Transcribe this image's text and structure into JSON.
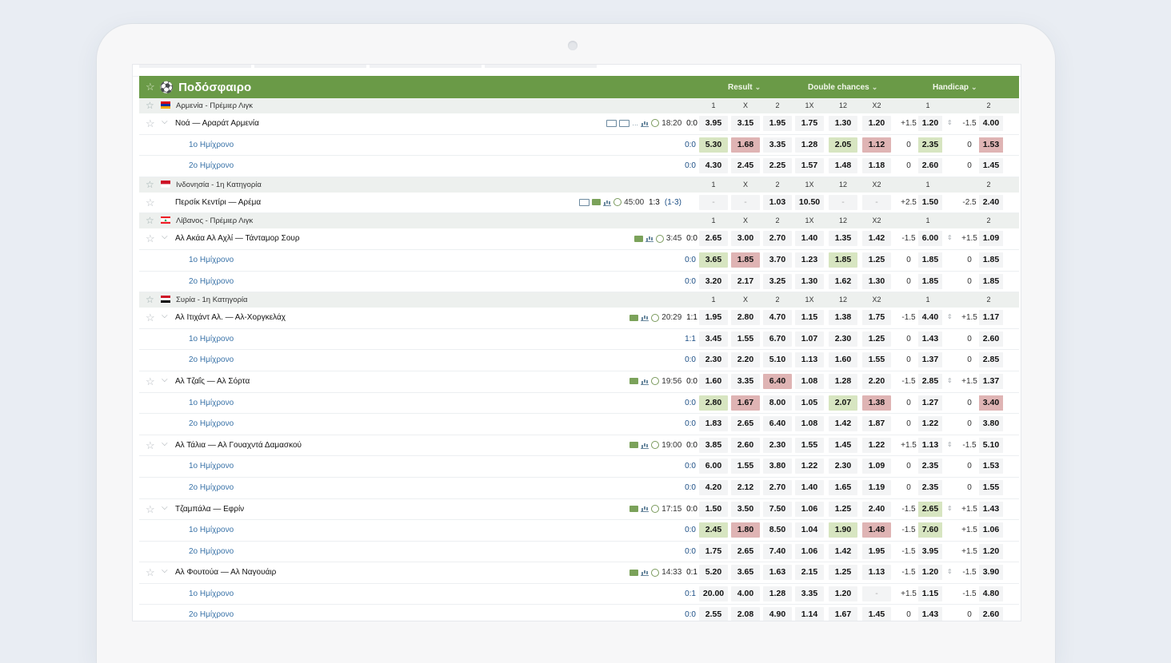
{
  "sport": {
    "title": "Ποδόσφαιρο",
    "tabs": [
      "Result",
      "Double chances",
      "Handicap"
    ]
  },
  "colLabels": [
    "1",
    "X",
    "2",
    "1X",
    "12",
    "X2",
    "1",
    "2"
  ],
  "blocks": [
    {
      "type": "league",
      "name": "Αρμενία - Πρέμιερ Λιγκ",
      "flag": "am"
    },
    {
      "type": "match",
      "name": "Νοά — Αραράτ Αρμενία",
      "icons": "tv",
      "time": "18:20",
      "score": "0:0",
      "odds": [
        "3.95",
        "3.15",
        "1.95",
        "1.75",
        "1.30",
        "1.20"
      ],
      "hc": [
        "+1.5",
        "1.20",
        "-1.5",
        "4.00"
      ],
      "colors": {}
    },
    {
      "type": "half",
      "name": "1ο Ημίχρονο",
      "score": "0:0",
      "odds": [
        "5.30",
        "1.68",
        "3.35",
        "1.28",
        "2.05",
        "1.12"
      ],
      "hc": [
        "0",
        "2.35",
        "0",
        "1.53"
      ],
      "colors": {
        "o0": "g",
        "o1": "r",
        "o4": "g",
        "o5": "r",
        "h1": "g",
        "h3": "r"
      }
    },
    {
      "type": "half",
      "name": "2ο Ημίχρονο",
      "score": "0:0",
      "odds": [
        "4.30",
        "2.45",
        "2.25",
        "1.57",
        "1.48",
        "1.18"
      ],
      "hc": [
        "0",
        "2.60",
        "0",
        "1.45"
      ],
      "colors": {}
    },
    {
      "type": "league",
      "name": "Ινδονησία - 1η Κατηγορία",
      "flag": "id"
    },
    {
      "type": "match",
      "name": "Περσίκ Κεντίρι — Αρέμα",
      "icons": "live",
      "time": "45:00",
      "score": "1:3",
      "sub": "(1-3)",
      "nochev": true,
      "odds": [
        "-",
        "-",
        "1.03",
        "10.50",
        "-",
        "-"
      ],
      "hc": [
        "+2.5",
        "1.50",
        "-2.5",
        "2.40"
      ],
      "colors": {}
    },
    {
      "type": "league",
      "name": "Λίβανος - Πρέμιερ Λιγκ",
      "flag": "lb"
    },
    {
      "type": "match",
      "name": "Αλ Ακάα Αλ Αχλί — Τάνταμορ Σουρ",
      "icons": "live2",
      "time": "3:45",
      "score": "0:0",
      "odds": [
        "2.65",
        "3.00",
        "2.70",
        "1.40",
        "1.35",
        "1.42"
      ],
      "hc": [
        "-1.5",
        "6.00",
        "+1.5",
        "1.09"
      ],
      "colors": {}
    },
    {
      "type": "half",
      "name": "1ο Ημίχρονο",
      "score": "0:0",
      "odds": [
        "3.65",
        "1.85",
        "3.70",
        "1.23",
        "1.85",
        "1.25"
      ],
      "hc": [
        "0",
        "1.85",
        "0",
        "1.85"
      ],
      "colors": {
        "o0": "g",
        "o1": "r",
        "o4": "g"
      }
    },
    {
      "type": "half",
      "name": "2ο Ημίχρονο",
      "score": "0:0",
      "odds": [
        "3.20",
        "2.17",
        "3.25",
        "1.30",
        "1.62",
        "1.30"
      ],
      "hc": [
        "0",
        "1.85",
        "0",
        "1.85"
      ],
      "colors": {}
    },
    {
      "type": "league",
      "name": "Συρία - 1η Κατηγορία",
      "flag": "sy"
    },
    {
      "type": "match",
      "name": "Αλ Ιτιχάντ Αλ. — Αλ-Χοργκελάχ",
      "icons": "live2",
      "time": "20:29",
      "score": "1:1",
      "odds": [
        "1.95",
        "2.80",
        "4.70",
        "1.15",
        "1.38",
        "1.75"
      ],
      "hc": [
        "-1.5",
        "4.40",
        "+1.5",
        "1.17"
      ],
      "colors": {}
    },
    {
      "type": "half",
      "name": "1ο Ημίχρονο",
      "score": "1:1",
      "odds": [
        "3.45",
        "1.55",
        "6.70",
        "1.07",
        "2.30",
        "1.25"
      ],
      "hc": [
        "0",
        "1.43",
        "0",
        "2.60"
      ],
      "colors": {}
    },
    {
      "type": "half",
      "name": "2ο Ημίχρονο",
      "score": "0:0",
      "odds": [
        "2.30",
        "2.20",
        "5.10",
        "1.13",
        "1.60",
        "1.55"
      ],
      "hc": [
        "0",
        "1.37",
        "0",
        "2.85"
      ],
      "colors": {}
    },
    {
      "type": "match",
      "name": "Αλ Τζαΐς — Αλ Σόρτα",
      "icons": "live2",
      "time": "19:56",
      "score": "0:0",
      "odds": [
        "1.60",
        "3.35",
        "6.40",
        "1.08",
        "1.28",
        "2.20"
      ],
      "hc": [
        "-1.5",
        "2.85",
        "+1.5",
        "1.37"
      ],
      "colors": {
        "o2": "r"
      }
    },
    {
      "type": "half",
      "name": "1ο Ημίχρονο",
      "score": "0:0",
      "odds": [
        "2.80",
        "1.67",
        "8.00",
        "1.05",
        "2.07",
        "1.38"
      ],
      "hc": [
        "0",
        "1.27",
        "0",
        "3.40"
      ],
      "colors": {
        "o0": "g",
        "o1": "r",
        "o4": "g",
        "o5": "r",
        "h3": "r"
      }
    },
    {
      "type": "half",
      "name": "2ο Ημίχρονο",
      "score": "0:0",
      "odds": [
        "1.83",
        "2.65",
        "6.40",
        "1.08",
        "1.42",
        "1.87"
      ],
      "hc": [
        "0",
        "1.22",
        "0",
        "3.80"
      ],
      "colors": {}
    },
    {
      "type": "match",
      "name": "Αλ Τάλια — Αλ Γουαχντά Δαμασκού",
      "icons": "live2",
      "time": "19:00",
      "score": "0:0",
      "odds": [
        "3.85",
        "2.60",
        "2.30",
        "1.55",
        "1.45",
        "1.22"
      ],
      "hc": [
        "+1.5",
        "1.13",
        "-1.5",
        "5.10"
      ],
      "colors": {}
    },
    {
      "type": "half",
      "name": "1ο Ημίχρονο",
      "score": "0:0",
      "odds": [
        "6.00",
        "1.55",
        "3.80",
        "1.22",
        "2.30",
        "1.09"
      ],
      "hc": [
        "0",
        "2.35",
        "0",
        "1.53"
      ],
      "colors": {}
    },
    {
      "type": "half",
      "name": "2ο Ημίχρονο",
      "score": "0:0",
      "odds": [
        "4.20",
        "2.12",
        "2.70",
        "1.40",
        "1.65",
        "1.19"
      ],
      "hc": [
        "0",
        "2.35",
        "0",
        "1.55"
      ],
      "colors": {}
    },
    {
      "type": "match",
      "name": "Τζαμπάλα — Εφρίν",
      "icons": "live2",
      "time": "17:15",
      "score": "0:0",
      "odds": [
        "1.50",
        "3.50",
        "7.50",
        "1.06",
        "1.25",
        "2.40"
      ],
      "hc": [
        "-1.5",
        "2.65",
        "+1.5",
        "1.43"
      ],
      "colors": {
        "h1": "g"
      }
    },
    {
      "type": "half",
      "name": "1ο Ημίχρονο",
      "score": "0:0",
      "odds": [
        "2.45",
        "1.80",
        "8.50",
        "1.04",
        "1.90",
        "1.48"
      ],
      "hc": [
        "-1.5",
        "7.60",
        "+1.5",
        "1.06"
      ],
      "colors": {
        "o0": "g",
        "o1": "r",
        "o4": "g",
        "o5": "r",
        "h1": "g"
      }
    },
    {
      "type": "half",
      "name": "2ο Ημίχρονο",
      "score": "0:0",
      "odds": [
        "1.75",
        "2.65",
        "7.40",
        "1.06",
        "1.42",
        "1.95"
      ],
      "hc": [
        "-1.5",
        "3.95",
        "+1.5",
        "1.20"
      ],
      "colors": {}
    },
    {
      "type": "match",
      "name": "Αλ Φουτούα — Αλ Ναγουάιρ",
      "icons": "live2",
      "time": "14:33",
      "score": "0:1",
      "odds": [
        "5.20",
        "3.65",
        "1.63",
        "2.15",
        "1.25",
        "1.13"
      ],
      "hc": [
        "-1.5",
        "1.20",
        "-1.5",
        "3.90"
      ],
      "colors": {}
    },
    {
      "type": "half",
      "name": "1ο Ημίχρονο",
      "score": "0:1",
      "odds": [
        "20.00",
        "4.00",
        "1.28",
        "3.35",
        "1.20",
        "-"
      ],
      "hc": [
        "+1.5",
        "1.15",
        "-1.5",
        "4.80"
      ],
      "colors": {}
    },
    {
      "type": "half",
      "name": "2ο Ημίχρονο",
      "score": "0:0",
      "odds": [
        "2.55",
        "2.08",
        "4.90",
        "1.14",
        "1.67",
        "1.45"
      ],
      "hc": [
        "0",
        "1.43",
        "0",
        "2.60"
      ],
      "colors": {}
    }
  ]
}
